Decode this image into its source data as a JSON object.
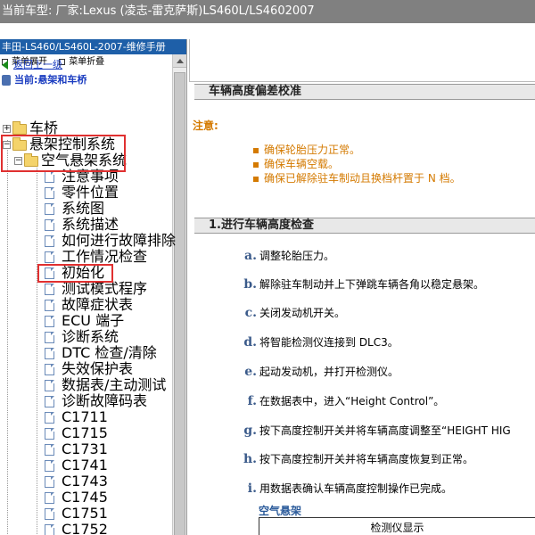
{
  "window_title": "当前车型:  厂家:Lexus (凌志-雷克萨斯)LS460L/LS4602007",
  "sidebar": {
    "title": "丰田-LS460/LS460L-2007-维修手册",
    "expand_all": "菜单展开",
    "collapse_all": "菜单折叠",
    "back_link": "返回上一级",
    "current": "当前:悬架和车桥",
    "tree": {
      "node_1": "车桥",
      "node_2": "悬架控制系统",
      "node_3": "空气悬架系统",
      "leaves": [
        "注意事项",
        "零件位置",
        "系统图",
        "系统描述",
        "如何进行故障排除",
        "工作情况检查",
        "初始化",
        "测试模式程序",
        "故障症状表",
        "ECU 端子",
        "诊断系统",
        "DTC 检查/清除",
        "失效保护表",
        "数据表/主动测试",
        "诊断故障码表",
        "C1711",
        "C1715",
        "C1731",
        "C1741",
        "C1743",
        "C1745",
        "C1751",
        "C1752"
      ]
    }
  },
  "main": {
    "section1_title": "车辆高度偏差校准",
    "note_label": "注意:",
    "notes": [
      "确保轮胎压力正常。",
      "确保车辆空载。",
      "确保已解除驻车制动且换档杆置于 N 档。"
    ],
    "section2_title": "1.进行车辆高度检查",
    "steps": [
      {
        "letter": "a.",
        "text": "调整轮胎压力。"
      },
      {
        "letter": "b.",
        "text": "解除驻车制动并上下弹跳车辆各角以稳定悬架。"
      },
      {
        "letter": "c.",
        "text": "关闭发动机开关。"
      },
      {
        "letter": "d.",
        "text": "将智能检测仪连接到 DLC3。"
      },
      {
        "letter": "e.",
        "text": "起动发动机，并打开检测仪。"
      },
      {
        "letter": "f.",
        "text": "在数据表中，进入“Height Control”。"
      },
      {
        "letter": "g.",
        "text": "按下高度控制开关并将车辆高度调整至“HEIGHT HIG"
      },
      {
        "letter": "h.",
        "text": "按下高度控制开关并将车辆高度恢复到正常。"
      },
      {
        "letter": "i.",
        "text": "用数据表确认车辆高度控制操作已完成。"
      }
    ],
    "subsection_title": "空气悬架",
    "table_header": "检测仪显示"
  },
  "colors": {
    "title_bar": "#808080",
    "sidebar_header": "#1e5fa8",
    "note_orange": "#d47a00",
    "link_blue": "#1a3cc0",
    "highlight_red": "#e03030"
  }
}
